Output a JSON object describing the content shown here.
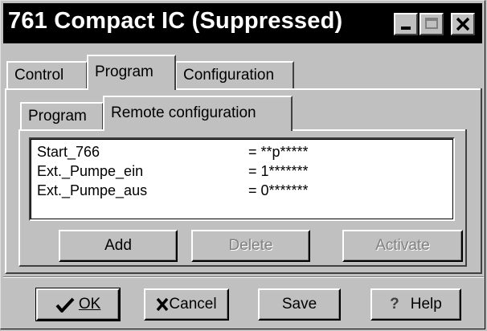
{
  "window": {
    "title": "761 Compact IC (Suppressed)"
  },
  "main_tabs": [
    "Control",
    "Program",
    "Configuration"
  ],
  "sub_tabs": [
    "Program",
    "Remote configuration"
  ],
  "remote_list": [
    {
      "name": "Start_766",
      "value": "= **p*****"
    },
    {
      "name": "Ext._Pumpe_ein",
      "value": "= 1*******"
    },
    {
      "name": "Ext._Pumpe_aus",
      "value": "= 0*******"
    }
  ],
  "list_buttons": {
    "add": "Add",
    "delete": "Delete",
    "activate": "Activate"
  },
  "dialog_buttons": {
    "ok": "OK",
    "cancel": "Cancel",
    "save": "Save",
    "help": "Help"
  },
  "icons": {
    "ok": "checkmark-icon",
    "cancel": "x-icon",
    "help": "question-mark-icon"
  }
}
